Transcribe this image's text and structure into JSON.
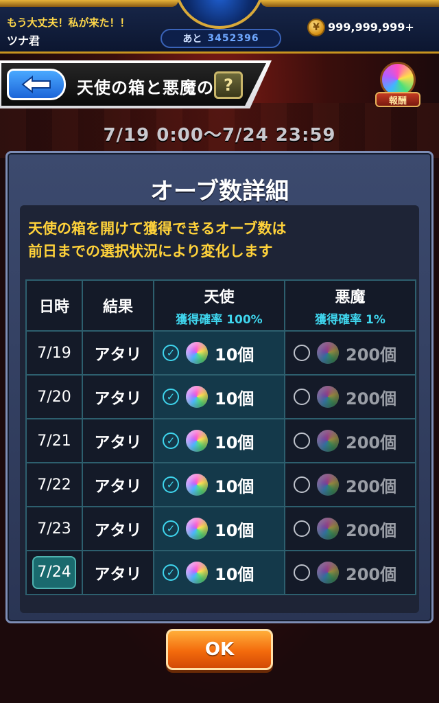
{
  "status_bar": {
    "message": "もう大丈夫！私が来た！！",
    "player_name": "ツナ君",
    "exp_label": "あと",
    "exp_value": "3452396",
    "coins": "999,999,999+"
  },
  "header": {
    "title": "天使の箱と悪魔の箱",
    "help_label": "?",
    "reward_label": "報酬",
    "period": "7/19 0:00〜7/24 23:59"
  },
  "dialog": {
    "title": "オーブ数詳細",
    "notice_line1": "天使の箱を開けて獲得できるオーブ数は",
    "notice_line2": "前日までの選択状況により変化します",
    "table": {
      "col_date": "日時",
      "col_result": "結果",
      "col_angel": "天使",
      "angel_rate": "獲得確率 100%",
      "col_devil": "悪魔",
      "devil_rate": "獲得確率 1%",
      "rows": [
        {
          "date": "7/19",
          "result": "アタリ",
          "angel_qty": "10個",
          "devil_qty": "200個"
        },
        {
          "date": "7/20",
          "result": "アタリ",
          "angel_qty": "10個",
          "devil_qty": "200個"
        },
        {
          "date": "7/21",
          "result": "アタリ",
          "angel_qty": "10個",
          "devil_qty": "200個"
        },
        {
          "date": "7/22",
          "result": "アタリ",
          "angel_qty": "10個",
          "devil_qty": "200個"
        },
        {
          "date": "7/23",
          "result": "アタリ",
          "angel_qty": "10個",
          "devil_qty": "200個"
        },
        {
          "date": "7/24",
          "result": "アタリ",
          "angel_qty": "10個",
          "devil_qty": "200個"
        }
      ]
    },
    "ok_label": "OK"
  },
  "colors": {
    "accent_gold": "#ffd23a",
    "accent_cyan": "#3fd6ee",
    "ok_button": "#f36a0c"
  },
  "icons": {
    "back": "back-arrow-icon",
    "help": "question-icon",
    "coin": "coin-icon",
    "orb": "orb-icon",
    "selected": "check-icon",
    "unselected": "radio-icon"
  }
}
